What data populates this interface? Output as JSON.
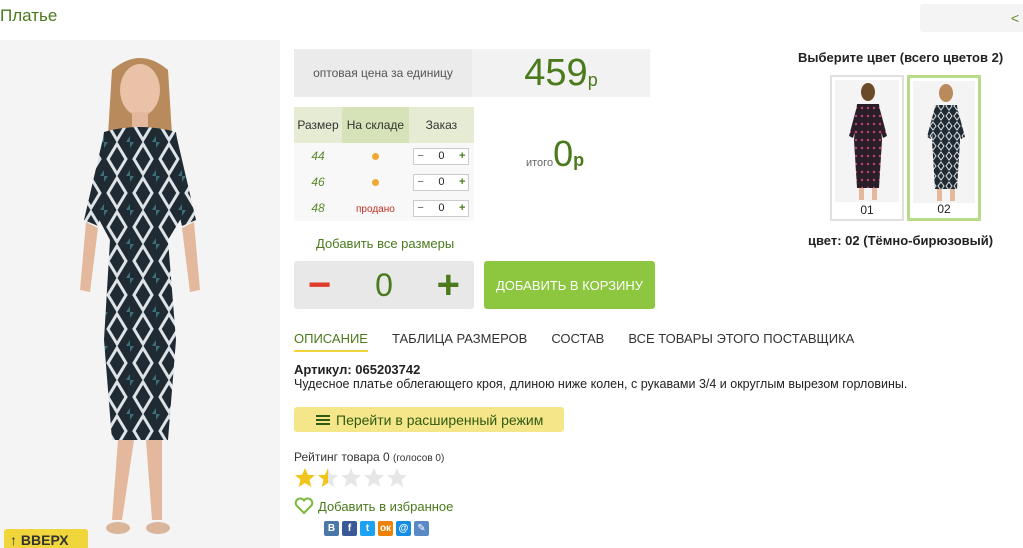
{
  "page": {
    "title": "Платье",
    "nav_prev": "<"
  },
  "photo": {
    "scroll_up": "↑ ВВЕРХ"
  },
  "price": {
    "label": "оптовая цена за единицу",
    "value": "459",
    "currency": "р"
  },
  "size_table": {
    "headers": [
      "Размер",
      "На складе",
      "Заказ"
    ],
    "rows": [
      {
        "size": "44",
        "stock": "dot",
        "qty": "0"
      },
      {
        "size": "46",
        "stock": "dot",
        "qty": "0"
      },
      {
        "size": "48",
        "stock": "продано",
        "qty": "0"
      }
    ],
    "stepper_minus": "−",
    "stepper_plus": "+"
  },
  "total": {
    "label": "итого",
    "value": "0",
    "currency": "р"
  },
  "add_all_sizes": "Добавить все размеры",
  "big_stepper": {
    "minus": "−",
    "qty": "0",
    "plus": "+"
  },
  "cart_button": "ДОБАВИТЬ В КОРЗИНУ",
  "tabs": [
    {
      "label": "ОПИСАНИЕ",
      "active": true
    },
    {
      "label": "ТАБЛИЦА РАЗМЕРОВ",
      "active": false
    },
    {
      "label": "СОСТАВ",
      "active": false
    },
    {
      "label": "ВСЕ ТОВАРЫ ЭТОГО ПОСТАВЩИКА",
      "active": false
    }
  ],
  "article": "Артикул: 065203742",
  "description": "Чудесное платье облегающего кроя, длиною ниже колен, с рукавами 3/4 и округлым вырезом горловины.",
  "advanced_mode": "Перейти в расширенный режим",
  "rating": {
    "label": "Рейтинг товара 0",
    "votes": "(голосов 0)",
    "stars_filled": 1.5,
    "stars_total": 5
  },
  "favorite": "Добавить в избранное",
  "social": [
    {
      "icon": "vk-icon",
      "glyph": "В",
      "color": "#4a76a8"
    },
    {
      "icon": "facebook-icon",
      "glyph": "f",
      "color": "#3b5998"
    },
    {
      "icon": "twitter-icon",
      "glyph": "t",
      "color": "#1da1f2"
    },
    {
      "icon": "odnoklassniki-icon",
      "glyph": "ок",
      "color": "#ee8208"
    },
    {
      "icon": "mailru-icon",
      "glyph": "@",
      "color": "#168de2"
    },
    {
      "icon": "livejournal-icon",
      "glyph": "✎",
      "color": "#5a8ac6"
    }
  ],
  "colors": {
    "title": "Выберите цвет (всего цветов 2)",
    "swatches": [
      {
        "label": "01",
        "selected": false
      },
      {
        "label": "02",
        "selected": true
      }
    ],
    "selected_name": "цвет: 02 (Тёмно-бирюзовый)"
  },
  "theme": {
    "accent": "#8dc63f",
    "text_green": "#4a7a1c",
    "highlight": "#f0d63a",
    "minus_red": "#e03a2a"
  }
}
